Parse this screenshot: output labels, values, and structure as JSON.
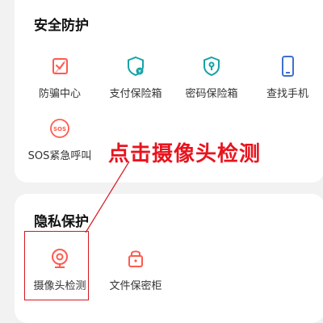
{
  "security": {
    "title": "安全防护",
    "items": [
      {
        "label": "防骗中心",
        "icon": "anti-fraud-shield-icon"
      },
      {
        "label": "支付保险箱",
        "icon": "payment-safe-icon"
      },
      {
        "label": "密码保险箱",
        "icon": "password-safe-icon"
      },
      {
        "label": "查找手机",
        "icon": "phone-icon"
      },
      {
        "label": "SOS紧急呼叫",
        "icon": "sos-icon"
      }
    ]
  },
  "privacy": {
    "title": "隐私保护",
    "items": [
      {
        "label": "摄像头检测",
        "icon": "camera-icon"
      },
      {
        "label": "文件保密柜",
        "icon": "lock-icon"
      }
    ]
  },
  "annotation": {
    "text": "点击摄像头检测"
  },
  "colors": {
    "icon_accent": "#ff5a4e",
    "icon_teal": "#16a3a6",
    "icon_blue": "#3f6fd1",
    "annotation_red": "#e8141e"
  }
}
